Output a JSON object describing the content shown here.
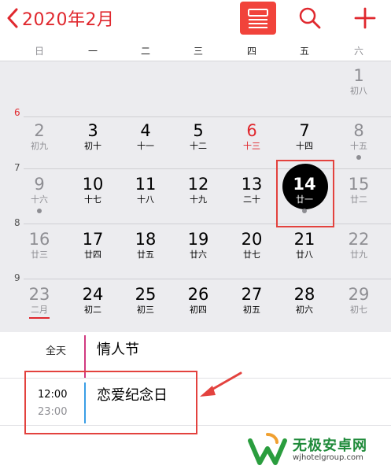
{
  "header": {
    "title": "2020年2月",
    "back_icon": "chevron-left-icon",
    "buttons": [
      {
        "name": "list-view-button",
        "icon": "list-view-icon",
        "active": true
      },
      {
        "name": "search-button",
        "icon": "search-icon"
      },
      {
        "name": "add-event-button",
        "icon": "plus-icon"
      }
    ]
  },
  "colors": {
    "accent": "#e0282e",
    "selected": "#000000",
    "allday_bar": "#d13a80",
    "event_bar": "#3a9ee6",
    "annotation": "#e3423e"
  },
  "weekdays": [
    "日",
    "一",
    "二",
    "三",
    "四",
    "五",
    "六"
  ],
  "month_labels": [
    {
      "label": "6",
      "current": true
    },
    {
      "label": "7"
    },
    {
      "label": "8"
    },
    {
      "label": "9"
    }
  ],
  "weeks": [
    [
      null,
      null,
      null,
      null,
      null,
      null,
      {
        "day": "1",
        "lunar": "初八"
      }
    ],
    [
      {
        "day": "2",
        "lunar": "初九"
      },
      {
        "day": "3",
        "lunar": "初十"
      },
      {
        "day": "4",
        "lunar": "十一"
      },
      {
        "day": "5",
        "lunar": "十二"
      },
      {
        "day": "6",
        "lunar": "十三",
        "today": true
      },
      {
        "day": "7",
        "lunar": "十四"
      },
      {
        "day": "8",
        "lunar": "十五",
        "dot": true
      }
    ],
    [
      {
        "day": "9",
        "lunar": "十六",
        "dot": true
      },
      {
        "day": "10",
        "lunar": "十七"
      },
      {
        "day": "11",
        "lunar": "十八"
      },
      {
        "day": "12",
        "lunar": "十九"
      },
      {
        "day": "13",
        "lunar": "二十"
      },
      {
        "day": "14",
        "lunar": "廿一",
        "selected": true,
        "dot": true
      },
      {
        "day": "15",
        "lunar": "廿二"
      }
    ],
    [
      {
        "day": "16",
        "lunar": "廿三"
      },
      {
        "day": "17",
        "lunar": "廿四"
      },
      {
        "day": "18",
        "lunar": "廿五"
      },
      {
        "day": "19",
        "lunar": "廿六"
      },
      {
        "day": "20",
        "lunar": "廿七"
      },
      {
        "day": "21",
        "lunar": "廿八"
      },
      {
        "day": "22",
        "lunar": "廿九"
      }
    ],
    [
      {
        "day": "23",
        "lunar": "二月",
        "underline": true
      },
      {
        "day": "24",
        "lunar": "初二"
      },
      {
        "day": "25",
        "lunar": "初三"
      },
      {
        "day": "26",
        "lunar": "初四"
      },
      {
        "day": "27",
        "lunar": "初五"
      },
      {
        "day": "28",
        "lunar": "初六"
      },
      {
        "day": "29",
        "lunar": "初七"
      }
    ]
  ],
  "events": {
    "allday": {
      "label": "全天",
      "title": "情人节"
    },
    "timed": {
      "start": "12:00",
      "end": "23:00",
      "title": "恋爱纪念日"
    }
  },
  "watermark": {
    "text": "无极安卓网",
    "url": "wjhotelgroup.com"
  }
}
